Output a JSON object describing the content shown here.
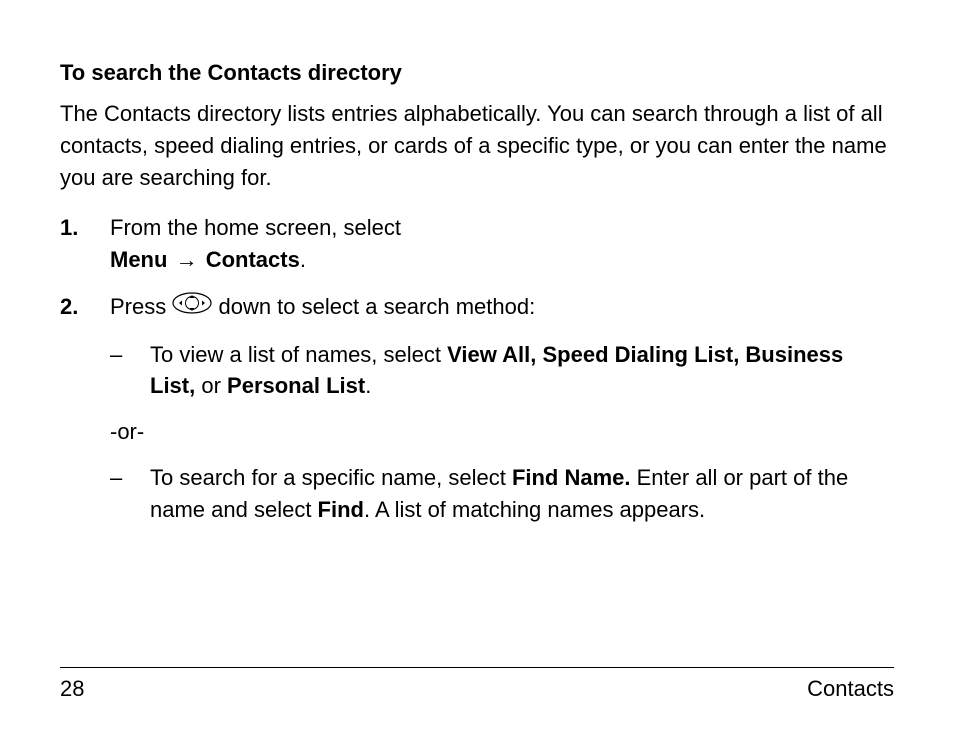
{
  "heading": "To search the Contacts directory",
  "intro": "The Contacts directory lists entries alphabetically. You can search through a list of all contacts, speed dialing entries, or cards of a specific type, or you can enter the name you are searching for.",
  "step1": {
    "lead": "From the home screen, select",
    "menu": "Menu",
    "arrow": "→",
    "contacts": "Contacts",
    "period": "."
  },
  "step2": {
    "press": "Press ",
    "after_icon": " down to select a search method:",
    "bullet1": {
      "dash": "–",
      "lead": "To view a list of names, select ",
      "b1": "View All, Speed Dialing List, Business List,",
      "mid": " or ",
      "b2": "Personal List",
      "period": "."
    },
    "or": "-or-",
    "bullet2": {
      "dash": "–",
      "lead": "To search for a specific name, select ",
      "b1": "Find Name.",
      "mid": " Enter all or part of the name and select ",
      "b2": "Find",
      "tail": ". A list of matching names appears."
    }
  },
  "footer": {
    "page": "28",
    "section": "Contacts"
  }
}
